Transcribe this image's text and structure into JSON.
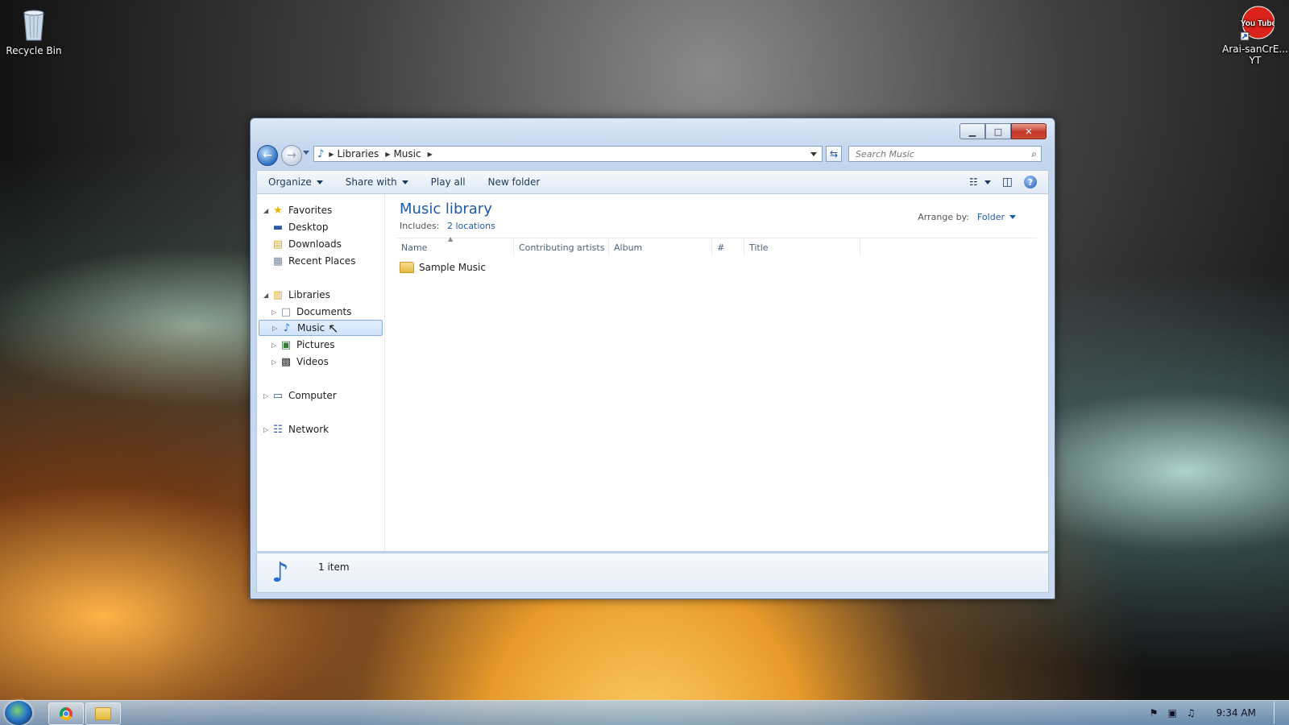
{
  "desktop": {
    "recycle_bin": "Recycle Bin",
    "youtube_shortcut_line1": "Arai-sanCrE...",
    "youtube_shortcut_line2": "YT",
    "youtube_logo_text": "You Tube"
  },
  "window": {
    "address": {
      "crumbs": [
        "Libraries",
        "Music"
      ]
    },
    "search_placeholder": "Search Music",
    "toolbar": {
      "organize": "Organize",
      "share_with": "Share with",
      "play_all": "Play all",
      "new_folder": "New folder"
    },
    "nav": {
      "favorites": "Favorites",
      "desktop": "Desktop",
      "downloads": "Downloads",
      "recent_places": "Recent Places",
      "libraries": "Libraries",
      "documents": "Documents",
      "music": "Music",
      "pictures": "Pictures",
      "videos": "Videos",
      "computer": "Computer",
      "network": "Network"
    },
    "library": {
      "title": "Music library",
      "includes_label": "Includes:",
      "includes_link": "2 locations",
      "arrange_label": "Arrange by:",
      "arrange_value": "Folder"
    },
    "columns": [
      "Name",
      "Contributing artists",
      "Album",
      "#",
      "Title"
    ],
    "items": [
      {
        "name": "Sample Music"
      }
    ],
    "status": "1 item"
  },
  "taskbar": {
    "clock": "9:34 AM"
  },
  "colors": {
    "accent": "#1e5aa8",
    "close_button": "#c3382a"
  }
}
